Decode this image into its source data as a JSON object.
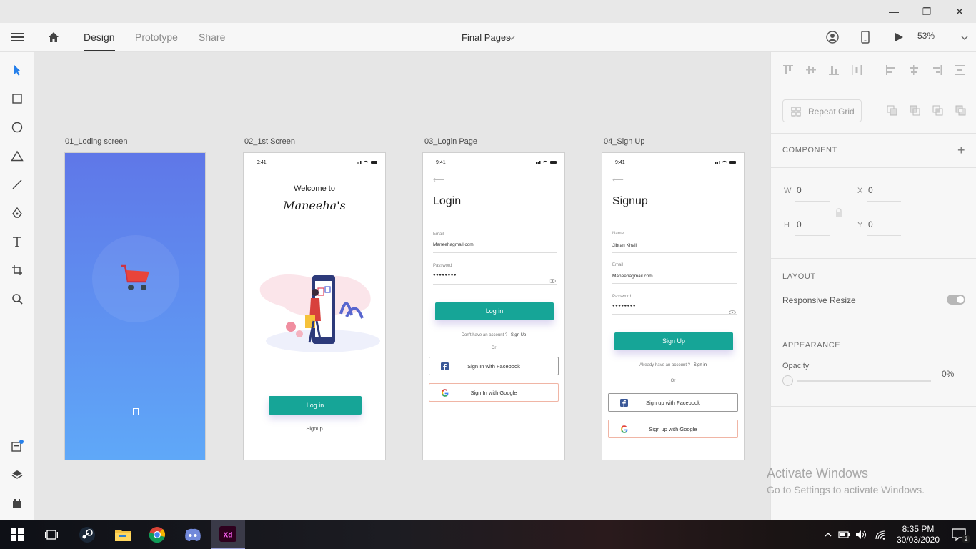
{
  "window": {
    "minimize_glyph": "—",
    "maximize_glyph": "❐",
    "close_glyph": "✕"
  },
  "toolbar": {
    "tabs": [
      "Design",
      "Prototype",
      "Share"
    ],
    "document_title": "Final Pages",
    "zoom": "53%"
  },
  "artboards": [
    {
      "label": "01_Loding screen"
    },
    {
      "label": "02_1st Screen",
      "time": "9:41",
      "welcome": "Welcome to",
      "brand": "Maneeha's",
      "login_button": "Log in",
      "signup_link": "Signup"
    },
    {
      "label": "03_Login Page",
      "time": "9:41",
      "back": "⟵",
      "title": "Login",
      "email_label": "Email",
      "email_value": "Maneehagmail.com",
      "password_label": "Password",
      "password_value": "●●●●●●●●",
      "login_button": "Log in",
      "no_account": "Don't have an account ?",
      "signup_link": "Sign Up",
      "or": "Or",
      "facebook": "Sign In with Facebook",
      "google": "Sign In with Google"
    },
    {
      "label": "04_Sign Up",
      "time": "9:41",
      "back": "⟵",
      "title": "Signup",
      "name_label": "Name",
      "name_value": "Jibran Khalil",
      "email_label": "Email",
      "email_value": "Maneehagmail.com",
      "password_label": "Password",
      "password_value": "●●●●●●●●",
      "signup_button": "Sign Up",
      "have_account": "Already have an account ?",
      "signin_link": "Sign in",
      "or": "Or",
      "facebook": "Sign up with Facebook",
      "google": "Sign up with Google"
    }
  ],
  "right_panel": {
    "repeat_grid": "Repeat Grid",
    "component": "COMPONENT",
    "w_label": "W",
    "w_value": "0",
    "x_label": "X",
    "x_value": "0",
    "h_label": "H",
    "h_value": "0",
    "y_label": "Y",
    "y_value": "0",
    "layout": "LAYOUT",
    "responsive_resize": "Responsive Resize",
    "responsive_resize_on": true,
    "appearance": "APPEARANCE",
    "opacity_label": "Opacity",
    "opacity_value": "0%"
  },
  "watermark": {
    "line1": "Activate Windows",
    "line2": "Go to Settings to activate Windows."
  },
  "taskbar": {
    "time": "8:35 PM",
    "date": "30/03/2020",
    "notifications": "2"
  },
  "colors": {
    "accent_blue": "#2680eb",
    "teal": "#16a597",
    "loading_gradient_top": "#5f77e8",
    "loading_gradient_bottom": "#5fa8f8"
  }
}
